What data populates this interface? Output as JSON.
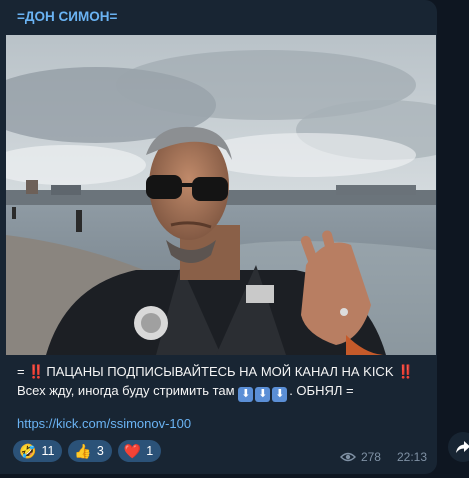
{
  "post": {
    "channel_name": "=ДОН СИМОН=",
    "line1_prefix": "= ",
    "line1_emoji_left": "‼️",
    "line1_text": "ПАЦАНЫ ПОДПИСЫВАЙТЕСЬ НА МОЙ КАНАЛ  НА KICK",
    "line1_emoji_right": "‼️",
    "line2_text": "Всех жду, иногда буду стримить там",
    "line2_arrows": [
      "⬇️",
      "⬇️",
      "⬇️"
    ],
    "line2_suffix": ". ОБНЯЛ =",
    "link": "https://kick.com/ssimonov-100"
  },
  "reactions": [
    {
      "emoji": "🤣",
      "count": "11"
    },
    {
      "emoji": "👍",
      "count": "3"
    },
    {
      "emoji": "❤️",
      "count": "1"
    }
  ],
  "meta": {
    "views": "278",
    "time": "22:13"
  },
  "colors": {
    "background": "#0e1621",
    "bubble": "#182533",
    "accent": "#6ab3f3",
    "reaction_bg": "#2b5278",
    "meta_text": "#7f91a4"
  },
  "icons": {
    "views": "eye-icon",
    "share": "share-arrow-icon"
  }
}
